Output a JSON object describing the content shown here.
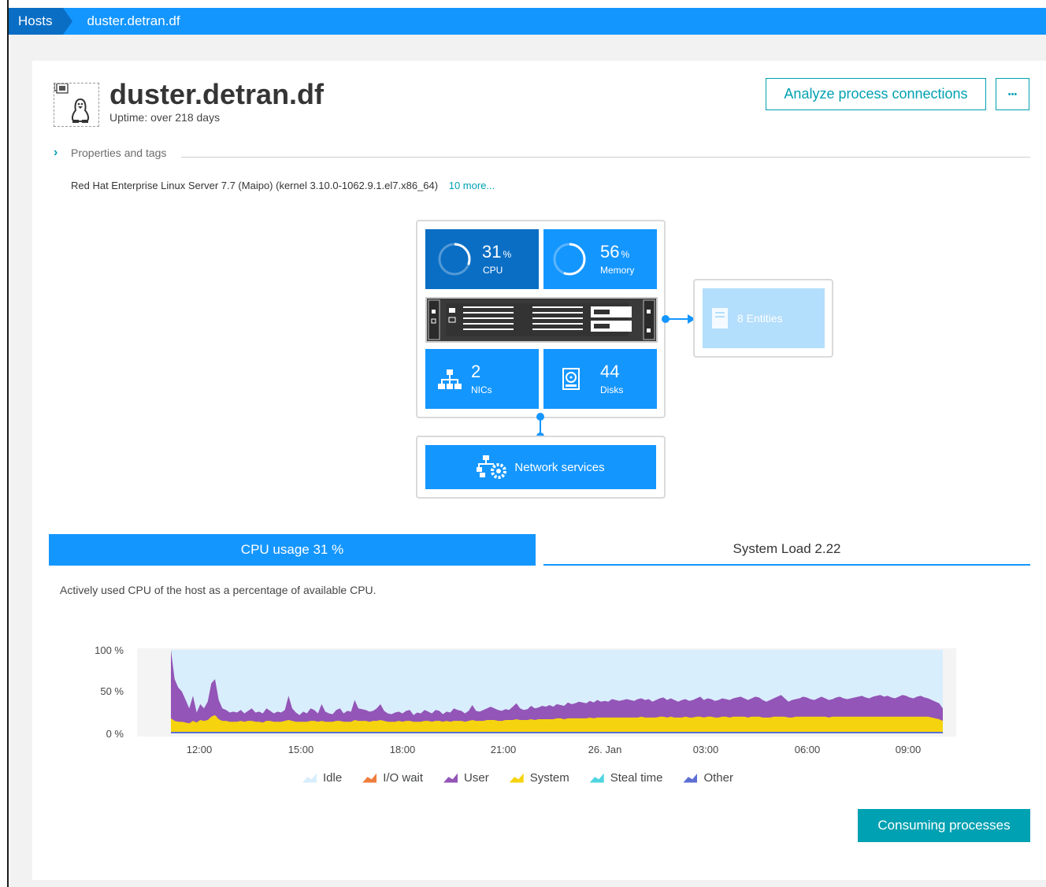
{
  "breadcrumb": {
    "root": "Hosts",
    "current": "duster.detran.df"
  },
  "host": {
    "name": "duster.detran.df",
    "uptime": "Uptime: over 218 days"
  },
  "actions": {
    "analyze_label": "Analyze process connections",
    "more_label": "•••"
  },
  "properties": {
    "label": "Properties and tags",
    "os": "Red Hat Enterprise Linux Server 7.7 (Maipo) (kernel 3.10.0-1062.9.1.el7.x86_64)",
    "more_link": "10 more..."
  },
  "infra": {
    "cpu": {
      "value": "31",
      "unit": "%",
      "label": "CPU",
      "percent": 31
    },
    "memory": {
      "value": "56",
      "unit": "%",
      "label": "Memory",
      "percent": 56
    },
    "nics": {
      "value": "2",
      "label": "NICs"
    },
    "disks": {
      "value": "44",
      "label": "Disks"
    },
    "entities": {
      "label": "8 Entities"
    },
    "network_services": {
      "label": "Network services"
    }
  },
  "tabs": [
    {
      "label": "CPU usage 31 %",
      "active": true
    },
    {
      "label": "System Load 2.22",
      "active": false
    }
  ],
  "chart_description": "Actively used CPU of the host as a percentage of available CPU.",
  "chart_data": {
    "type": "area",
    "y_ticks": [
      "100 %",
      "50 %",
      "0 %"
    ],
    "ylim": [
      0,
      100
    ],
    "x_ticks": [
      "12:00",
      "15:00",
      "18:00",
      "21:00",
      "26. Jan",
      "03:00",
      "06:00",
      "09:00"
    ],
    "series": [
      {
        "name": "Idle",
        "color": "#d9eefc"
      },
      {
        "name": "I/O wait",
        "color": "#ef7d3c"
      },
      {
        "name": "User",
        "color": "#9355b7"
      },
      {
        "name": "System",
        "color": "#f5d30f"
      },
      {
        "name": "Steal time",
        "color": "#4fd5e0"
      },
      {
        "name": "Other",
        "color": "#5d6fd3"
      }
    ],
    "user_top": [
      100,
      65,
      55,
      50,
      40,
      30,
      45,
      25,
      35,
      30,
      38,
      60,
      65,
      40,
      30,
      28,
      25,
      26,
      25,
      28,
      24,
      27,
      30,
      25,
      26,
      24,
      30,
      27,
      24,
      26,
      25,
      28,
      45,
      30,
      25,
      22,
      26,
      24,
      30,
      28,
      24,
      35,
      26,
      24,
      23,
      28,
      30,
      24,
      27,
      26,
      40,
      30,
      29,
      28,
      26,
      27,
      30,
      35,
      27,
      24,
      23,
      25,
      26,
      24,
      27,
      28,
      22,
      25,
      24,
      28,
      26,
      24,
      28,
      27,
      23,
      26,
      25,
      30,
      28,
      27,
      24,
      27,
      34,
      27,
      26,
      28,
      30,
      32,
      30,
      28,
      27,
      29,
      28,
      32,
      36,
      30,
      28,
      29,
      33,
      30,
      31,
      33,
      32,
      34,
      32,
      35,
      34,
      33,
      37,
      35,
      36,
      38,
      37,
      36,
      39,
      37,
      40,
      38,
      39,
      38,
      41,
      40,
      39,
      40,
      41,
      40,
      39,
      41,
      42,
      40,
      41,
      38,
      40,
      42,
      43,
      40,
      42,
      40,
      38,
      40,
      41,
      39,
      40,
      42,
      44,
      40,
      42,
      41,
      39,
      40,
      42,
      41,
      40,
      42,
      43,
      44,
      42,
      40,
      42,
      44,
      43,
      40,
      38,
      40,
      42,
      44,
      46,
      42,
      38,
      40,
      41,
      42,
      44,
      43,
      41,
      40,
      42,
      44,
      42,
      40,
      41,
      43,
      44,
      42,
      41,
      42,
      43,
      44,
      45,
      43,
      42,
      44,
      45,
      46,
      44,
      45,
      43,
      42,
      44,
      46,
      45,
      43,
      42,
      44,
      45,
      43,
      42,
      40,
      38,
      36,
      30
    ],
    "system_top": [
      18,
      15,
      14,
      14,
      13,
      12,
      15,
      13,
      16,
      15,
      16,
      20,
      22,
      17,
      15,
      15,
      14,
      14,
      14,
      15,
      14,
      15,
      15,
      14,
      14,
      13,
      15,
      15,
      14,
      14,
      14,
      15,
      16,
      15,
      14,
      14,
      14,
      14,
      15,
      15,
      14,
      15,
      14,
      14,
      14,
      15,
      15,
      14,
      14,
      14,
      16,
      15,
      15,
      15,
      14,
      15,
      15,
      16,
      15,
      14,
      14,
      14,
      15,
      14,
      15,
      15,
      14,
      14,
      14,
      15,
      15,
      14,
      15,
      15,
      14,
      15,
      14,
      15,
      15,
      15,
      14,
      15,
      16,
      15,
      15,
      15,
      16,
      16,
      16,
      15,
      15,
      16,
      16,
      16,
      17,
      16,
      16,
      16,
      17,
      16,
      17,
      17,
      17,
      17,
      17,
      18,
      18,
      17,
      18,
      18,
      18,
      18,
      18,
      18,
      19,
      18,
      19,
      19,
      19,
      19,
      19,
      19,
      19,
      19,
      19,
      19,
      19,
      19,
      20,
      19,
      19,
      19,
      19,
      20,
      20,
      19,
      20,
      19,
      19,
      19,
      20,
      19,
      19,
      20,
      20,
      19,
      20,
      20,
      19,
      19,
      20,
      20,
      19,
      20,
      20,
      20,
      20,
      19,
      20,
      20,
      20,
      19,
      19,
      19,
      20,
      20,
      20,
      20,
      19,
      19,
      20,
      20,
      20,
      20,
      20,
      20,
      20,
      20,
      20,
      19,
      20,
      20,
      20,
      20,
      20,
      20,
      20,
      20,
      20,
      20,
      20,
      20,
      20,
      20,
      20,
      20,
      20,
      20,
      20,
      20,
      20,
      20,
      20,
      20,
      20,
      20,
      20,
      19,
      18,
      17,
      15
    ]
  }
}
